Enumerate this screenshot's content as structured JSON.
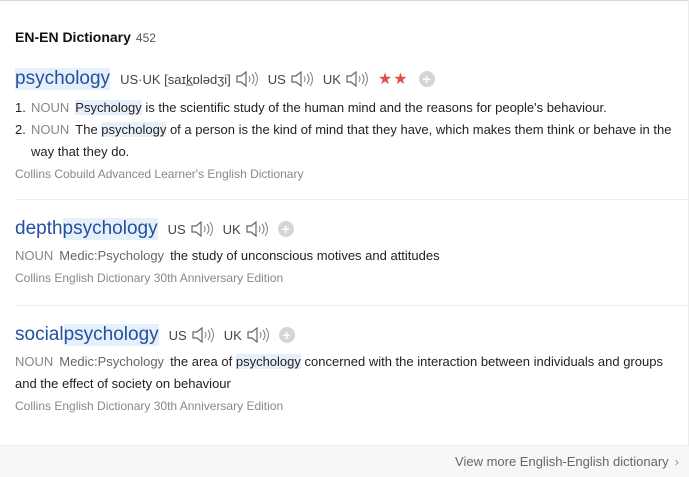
{
  "header": {
    "title": "EN-EN Dictionary",
    "count": "452"
  },
  "entries": [
    {
      "word": "psychology",
      "pron": {
        "combined": "US·UK [saɪk̲ɒlədʒi]",
        "us": "US",
        "uk": "UK"
      },
      "stars": "★★",
      "defs": [
        {
          "num": "1.",
          "pos": "NOUN",
          "pre": "",
          "hl": "Psychology",
          "post": " is the scientific study of the human mind and the reasons for people's behaviour."
        },
        {
          "num": "2.",
          "pos": "NOUN",
          "pre": "The ",
          "hl": "psychology",
          "post": " of a person is the kind of mind that they have, which makes them think or behave in the way that they do."
        }
      ],
      "source": "Collins Cobuild Advanced Learner's English Dictionary"
    },
    {
      "word_pre": "depth ",
      "word": "psychology",
      "pron": {
        "us": "US",
        "uk": "UK"
      },
      "def": {
        "pos": "NOUN",
        "tag": "Medic:Psychology",
        "text": "the study of unconscious motives and attitudes"
      },
      "source": "Collins English Dictionary 30th Anniversary Edition"
    },
    {
      "word_pre": "social ",
      "word": "psychology",
      "pron": {
        "us": "US",
        "uk": "UK"
      },
      "def": {
        "pos": "NOUN",
        "tag": "Medic:Psychology",
        "pre": "the area of ",
        "hl": "psychology",
        "post": " concerned with the interaction between individuals and groups and the effect of society on behaviour"
      },
      "source": "Collins English Dictionary 30th Anniversary Edition"
    }
  ],
  "footer": {
    "more": "View more English-English dictionary",
    "chevron": "›"
  },
  "colors": {
    "word": "#2350a0",
    "highlight": "#e6f0fb",
    "star": "#e0504a"
  },
  "icons": {
    "speaker": "speaker-icon",
    "add": "add-icon"
  }
}
